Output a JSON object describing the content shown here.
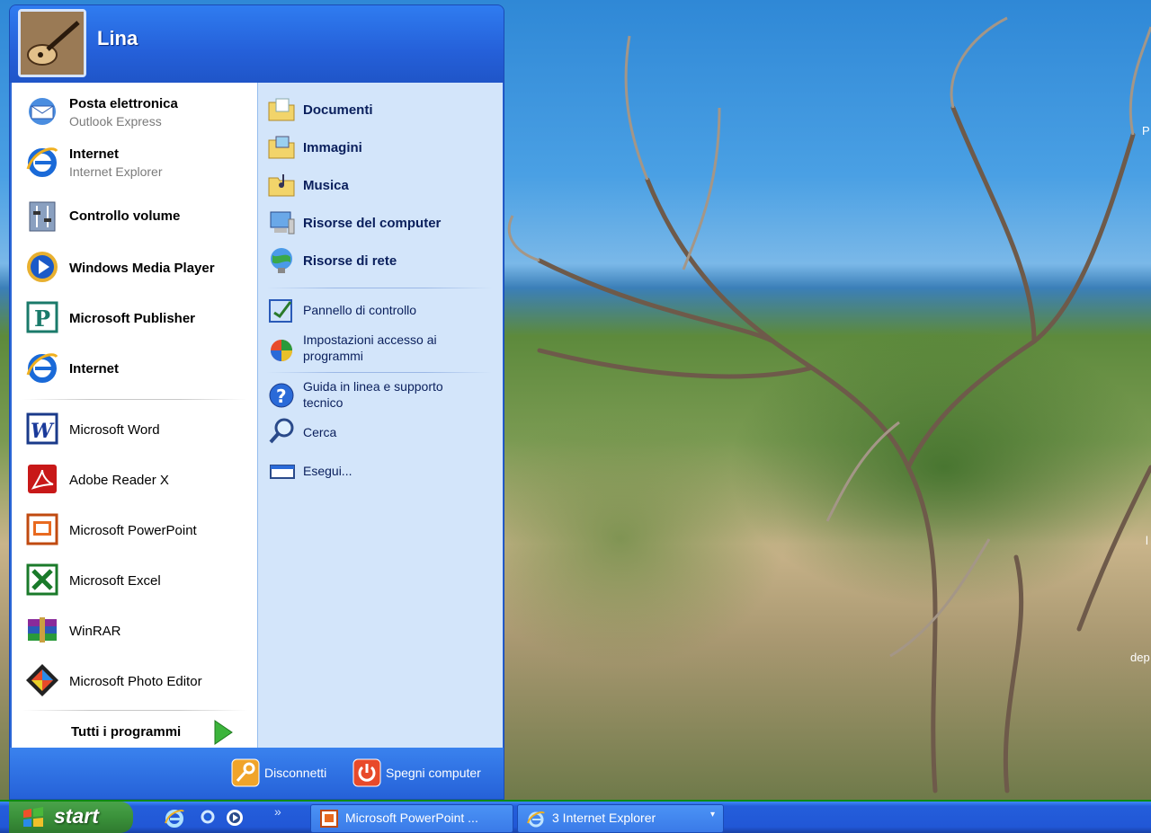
{
  "user": {
    "name": "Lina"
  },
  "pinned": [
    {
      "name": "Posta elettronica",
      "sub": "Outlook Express",
      "icon": "email-icon"
    },
    {
      "name": "Internet",
      "sub": "Internet Explorer",
      "icon": "internet-explorer-icon"
    },
    {
      "name": "Controllo volume",
      "icon": "volume-control-icon"
    },
    {
      "name": "Windows Media Player",
      "icon": "media-player-icon"
    },
    {
      "name": "Microsoft Publisher",
      "icon": "publisher-icon"
    },
    {
      "name": "Internet",
      "icon": "internet-explorer-icon"
    }
  ],
  "recent": [
    {
      "name": "Microsoft Word",
      "icon": "word-icon"
    },
    {
      "name": "Adobe Reader X",
      "icon": "adobe-reader-icon"
    },
    {
      "name": "Microsoft PowerPoint",
      "icon": "powerpoint-icon"
    },
    {
      "name": "Microsoft Excel",
      "icon": "excel-icon"
    },
    {
      "name": "WinRAR",
      "icon": "winrar-icon"
    },
    {
      "name": "Microsoft Photo Editor",
      "icon": "photo-editor-icon"
    }
  ],
  "all_programs": "Tutti i programmi",
  "places": [
    {
      "label": "Documenti",
      "icon": "documents-folder-icon"
    },
    {
      "label": "Immagini",
      "icon": "pictures-folder-icon"
    },
    {
      "label": "Musica",
      "icon": "music-folder-icon"
    },
    {
      "label": "Risorse del computer",
      "icon": "my-computer-icon"
    },
    {
      "label": "Risorse di rete",
      "icon": "network-icon"
    }
  ],
  "system": [
    {
      "label": "Pannello di controllo",
      "icon": "control-panel-icon"
    },
    {
      "label": "Impostazioni accesso ai programmi",
      "line1": "Impostazioni accesso ai",
      "line2": "programmi",
      "icon": "program-access-icon"
    }
  ],
  "support": [
    {
      "label": "Guida in linea e supporto tecnico",
      "line1": "Guida in linea e supporto",
      "line2": "tecnico",
      "icon": "help-icon"
    },
    {
      "label": "Cerca",
      "icon": "search-icon"
    },
    {
      "label": "Esegui...",
      "icon": "run-icon"
    }
  ],
  "footer": {
    "logoff": "Disconnetti",
    "shutdown": "Spegni computer"
  },
  "taskbar": {
    "start": "start",
    "quick_launch": [
      "internet-explorer-icon",
      "search-icon",
      "media-player-icon"
    ],
    "overflow": "»",
    "tasks": [
      {
        "label": "Microsoft PowerPoint ...",
        "icon": "powerpoint-icon"
      },
      {
        "label": "3 Internet Explorer",
        "icon": "internet-explorer-icon",
        "group_count": "3",
        "name": "Internet Explorer"
      }
    ]
  },
  "desktop_edge_text": [
    "P",
    "l",
    "dep"
  ],
  "colors": {
    "menu_blue": "#2a66d6",
    "right_pane": "#d3e5fa",
    "start_green": "#3a913a",
    "border_green": "#0e8a12"
  }
}
